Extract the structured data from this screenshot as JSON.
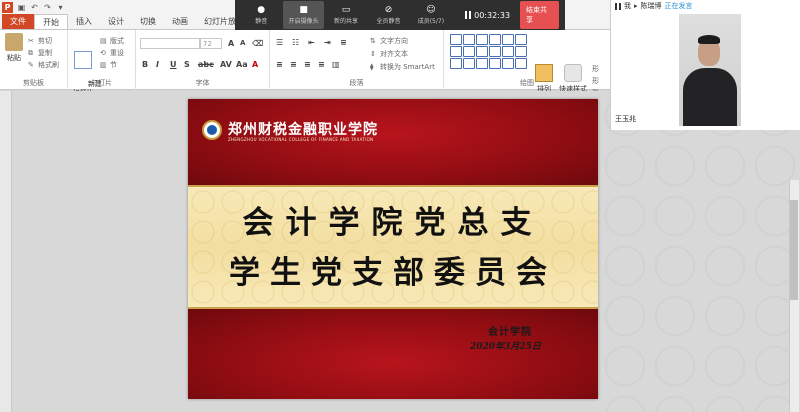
{
  "quick_access": {
    "app_logo": "P",
    "icons": [
      "save-icon",
      "undo-icon",
      "redo-icon",
      "customize-icon"
    ]
  },
  "ribbon_tabs": [
    "文件",
    "开始",
    "插入",
    "设计",
    "切换",
    "动画",
    "幻灯片放映"
  ],
  "meeting": {
    "buttons": [
      {
        "label": "静音",
        "icon": "microphone-icon"
      },
      {
        "label": "开启摄像头",
        "icon": "camera-icon"
      },
      {
        "label": "新的共享",
        "icon": "share-icon"
      },
      {
        "label": "全员静音",
        "icon": "mute-all-icon"
      },
      {
        "label": "成员(5/7)",
        "icon": "members-icon"
      }
    ],
    "timer": "00:32:33",
    "end_share": "结束共享"
  },
  "ribbon": {
    "clipboard": {
      "label": "剪贴板",
      "paste": "粘贴",
      "cut": "剪切",
      "copy": "复制",
      "format_painter": "格式刷"
    },
    "slides": {
      "label": "幻灯片",
      "new_slide": "新建\n幻灯片",
      "layout": "版式",
      "reset": "重设",
      "section": "节"
    },
    "font": {
      "label": "字体",
      "size": "72"
    },
    "paragraph": {
      "label": "段落",
      "text_direction": "文字方向",
      "align_text": "对齐文本",
      "smartart": "转换为 SmartArt"
    },
    "drawing": {
      "label": "绘图",
      "arrange": "排列",
      "quick_styles": "快速样式",
      "shape_fill": "形",
      "shape_outline": "形",
      "shape_effects": "形"
    }
  },
  "slide": {
    "university_cn": "郑州财税金融职业学院",
    "university_en": "ZHENGZHOU VOCATIONAL COLLEGE OF FINANCE AND TAXATION",
    "title_line_1": "会计学院党总支",
    "title_line_2": "学生党支部委员会",
    "department": "会计学院",
    "date": "2020年3月25日"
  },
  "video_panel": {
    "me_label": "我",
    "speaker": "陈瑞博",
    "status": "正在发言",
    "participant_name": "王玉兆"
  },
  "colors": {
    "slide_red": "#8f0d12",
    "slide_gold": "#f3dea0",
    "end_share": "#e65050",
    "file_tab": "#d24726"
  }
}
